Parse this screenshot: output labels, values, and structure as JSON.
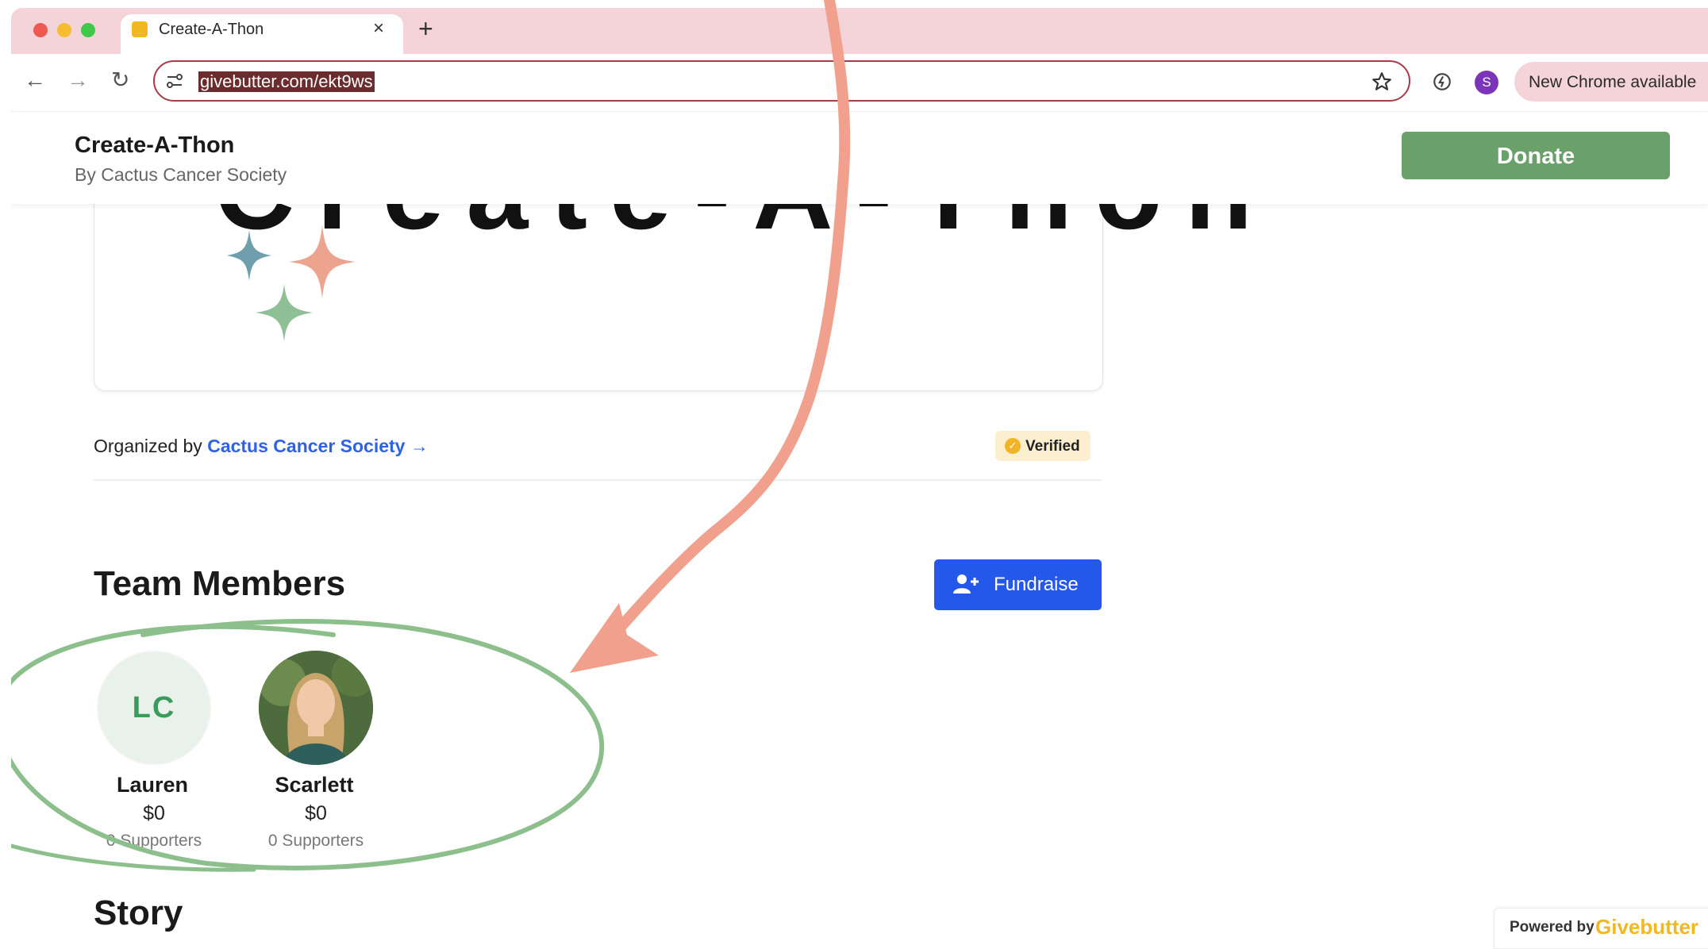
{
  "browser": {
    "tab_title": "Create-A-Thon",
    "close_glyph": "×",
    "new_tab_glyph": "+",
    "url": "givebutter.com/ekt9ws",
    "profile_initial": "S",
    "update_chip": "New Chrome available",
    "icons": [
      "back-arrow-icon",
      "forward-arrow-icon",
      "reload-icon",
      "site-settings-icon",
      "star-icon",
      "extension-icon"
    ]
  },
  "header": {
    "title": "Create-A-Thon",
    "subtitle": "By Cactus Cancer Society",
    "donate_label": "Donate"
  },
  "banner": {
    "text": "Create-A-Thon"
  },
  "organizer": {
    "prefix": "Organized by ",
    "name": "Cactus Cancer Society →",
    "badge": "Verified"
  },
  "team": {
    "title": "Team Members",
    "fundraise_label": "Fundraise",
    "members": [
      {
        "initials": "LC",
        "name": "Lauren",
        "amount": "$0",
        "supporters": "0 Supporters"
      },
      {
        "initials": "",
        "name": "Scarlett",
        "amount": "$0",
        "supporters": "0 Supporters"
      }
    ]
  },
  "story": {
    "title": "Story"
  },
  "footer": {
    "powered_prefix": "Powered by",
    "powered_brand": "Givebutter"
  },
  "colors": {
    "tab_strip": "#f4d4d8",
    "donate": "#6aa06a",
    "fundraise": "#2458ea",
    "link": "#2e62e6",
    "arrow_annotation": "#f0a08c",
    "circle_annotation": "#8cbf8c",
    "brand": "#f2b822"
  }
}
